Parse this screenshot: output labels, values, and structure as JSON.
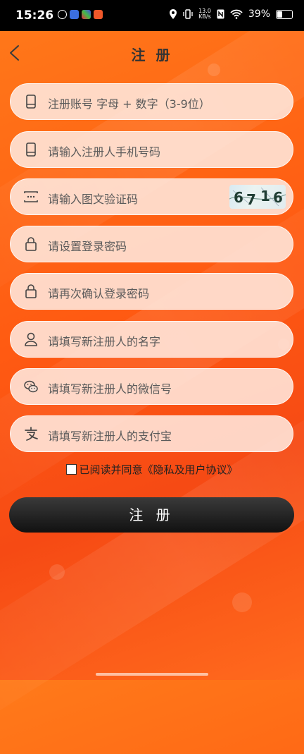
{
  "status_bar": {
    "time": "15:26",
    "net_speed_value": "13.0",
    "net_speed_unit": "KB/s",
    "battery": "39%"
  },
  "header": {
    "title": "注 册"
  },
  "fields": [
    {
      "icon": "phone-icon",
      "placeholder": "注册账号 字母 + 数字（3-9位）"
    },
    {
      "icon": "phone-icon",
      "placeholder": "请输入注册人手机号码"
    },
    {
      "icon": "captcha-icon",
      "placeholder": "请输入图文验证码"
    },
    {
      "icon": "lock-icon",
      "placeholder": "请设置登录密码"
    },
    {
      "icon": "lock-icon",
      "placeholder": "请再次确认登录密码"
    },
    {
      "icon": "user-icon",
      "placeholder": "请填写新注册人的名字"
    },
    {
      "icon": "wechat-icon",
      "placeholder": "请填写新注册人的微信号"
    },
    {
      "icon": "alipay-icon",
      "placeholder": "请填写新注册人的支付宝"
    }
  ],
  "captcha": {
    "digits": [
      "6",
      "7",
      "1",
      "6"
    ]
  },
  "agreement": {
    "prefix": "已阅读并同意",
    "link": "《隐私及用户协议》",
    "checked": false
  },
  "submit": {
    "label": "注 册"
  },
  "colors": {
    "accent": "#ff5a12",
    "button": "#1a1a1a"
  }
}
